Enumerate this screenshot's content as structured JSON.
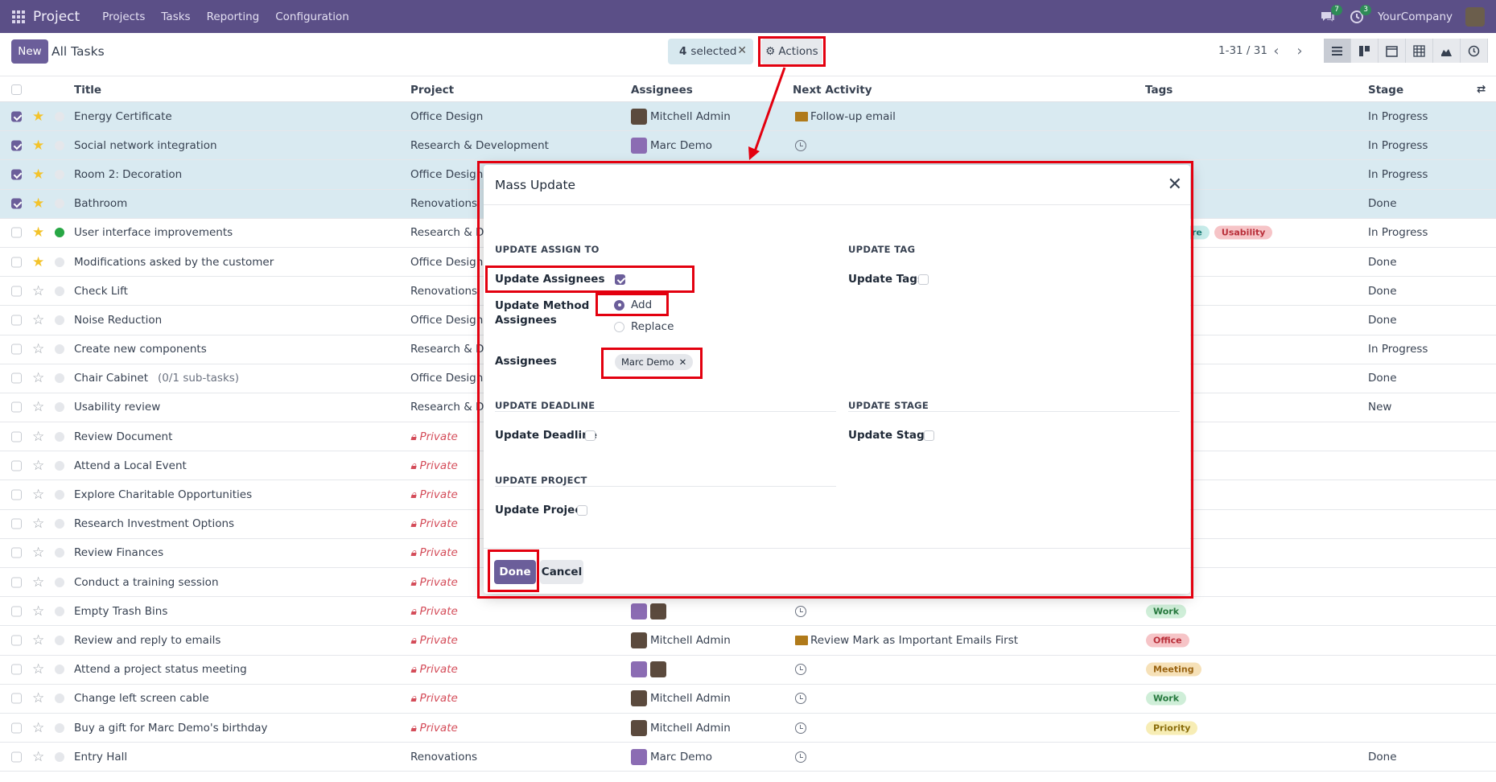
{
  "navbar": {
    "app_name": "Project",
    "menu": [
      "Projects",
      "Tasks",
      "Reporting",
      "Configuration"
    ],
    "messages_count": "7",
    "activities_count": "3",
    "company": "YourCompany"
  },
  "control_panel": {
    "new_label": "New",
    "title": "All Tasks",
    "selected_count": "4",
    "selected_text": "selected",
    "actions_label": "Actions",
    "pager": "1-31 / 31"
  },
  "table": {
    "headers": {
      "title": "Title",
      "project": "Project",
      "assignees": "Assignees",
      "activity": "Next Activity",
      "tags": "Tags",
      "stage": "Stage"
    },
    "rows": [
      {
        "title": "Energy Certificate",
        "project": "Office Design",
        "assignee": "Mitchell Admin",
        "activity": "Follow-up email",
        "stage": "In Progress"
      },
      {
        "title": "Social network integration",
        "project": "Research & Development",
        "assignee": "Marc Demo",
        "activity": "",
        "stage": "In Progress"
      },
      {
        "title": "Room 2: Decoration",
        "project": "Office Design",
        "assignee": "",
        "activity": "",
        "stage": "In Progress"
      },
      {
        "title": "Bathroom",
        "project": "Renovations",
        "assignee": "",
        "activity": "",
        "stage": "Done"
      },
      {
        "title": "User interface improvements",
        "project": "Research & De",
        "assignee": "",
        "activity": "",
        "tag1": "re",
        "tag2": "Usability",
        "stage": "In Progress"
      },
      {
        "title": "Modifications asked by the customer",
        "project": "Office Design",
        "assignee": "",
        "activity": "",
        "stage": "Done"
      },
      {
        "title": "Check Lift",
        "project": "Renovations",
        "assignee": "",
        "activity": "",
        "stage": "Done"
      },
      {
        "title": "Noise Reduction",
        "project": "Office Design",
        "assignee": "",
        "activity": "",
        "stage": "Done"
      },
      {
        "title": "Create new components",
        "project": "Research & De",
        "assignee": "",
        "activity": "",
        "stage": "In Progress"
      },
      {
        "title": "Chair Cabinet",
        "subtasks": "(0/1 sub-tasks)",
        "project": "Office Design",
        "assignee": "",
        "activity": "",
        "stage": "Done"
      },
      {
        "title": "Usability review",
        "project": "Research & De",
        "assignee": "",
        "activity": "",
        "stage": "New"
      },
      {
        "title": "Review Document",
        "project": "Private",
        "assignee": "",
        "activity": "",
        "stage": ""
      },
      {
        "title": "Attend a Local Event",
        "project": "Private",
        "assignee": "",
        "activity": "",
        "stage": ""
      },
      {
        "title": "Explore Charitable Opportunities",
        "project": "Private",
        "assignee": "",
        "activity": "",
        "stage": ""
      },
      {
        "title": "Research Investment Options",
        "project": "Private",
        "assignee": "",
        "activity": "",
        "stage": ""
      },
      {
        "title": "Review Finances",
        "project": "Private",
        "assignee": "",
        "activity": "",
        "stage": ""
      },
      {
        "title": "Conduct a training session",
        "project": "Private",
        "assignee": "",
        "activity": "",
        "stage": ""
      },
      {
        "title": "Empty Trash Bins",
        "project": "Private",
        "assignee": "",
        "activity": "",
        "tag1": "Work",
        "stage": ""
      },
      {
        "title": "Review and reply to emails",
        "project": "Private",
        "assignee": "Mitchell Admin",
        "activity": "Review Mark as Important Emails First",
        "tag1": "Office",
        "stage": ""
      },
      {
        "title": "Attend a project status meeting",
        "project": "Private",
        "assignee": "",
        "activity": "",
        "tag1": "Meeting",
        "stage": ""
      },
      {
        "title": "Change left screen cable",
        "project": "Private",
        "assignee": "Mitchell Admin",
        "activity": "",
        "tag1": "Work",
        "stage": ""
      },
      {
        "title": "Buy a gift for Marc Demo's birthday",
        "project": "Private",
        "assignee": "Mitchell Admin",
        "activity": "",
        "tag1": "Priority",
        "stage": ""
      },
      {
        "title": "Entry Hall",
        "project": "Renovations",
        "assignee": "Marc Demo",
        "activity": "",
        "stage": "Done"
      }
    ]
  },
  "modal": {
    "title": "Mass Update",
    "sec_assign": "UPDATE ASSIGN TO",
    "sec_tag": "UPDATE TAG",
    "update_assignees": "Update Assignees",
    "update_tags": "Update Tags",
    "update_method_l1": "Update Method",
    "update_method_l2": "Assignees",
    "opt_add": "Add",
    "opt_replace": "Replace",
    "assignees_label": "Assignees",
    "assignee_chip": "Marc Demo",
    "sec_deadline": "UPDATE DEADLINE",
    "sec_stage": "UPDATE STAGE",
    "update_deadline": "Update Deadline",
    "update_stage": "Update Stage",
    "sec_project": "UPDATE PROJECT",
    "update_project": "Update Project",
    "done_label": "Done",
    "cancel_label": "Cancel"
  },
  "colors": {
    "navbar": "#5b4f87",
    "primary": "#6b5e9a",
    "highlight": "#e3000f",
    "selected_row": "#d9eaf1"
  }
}
